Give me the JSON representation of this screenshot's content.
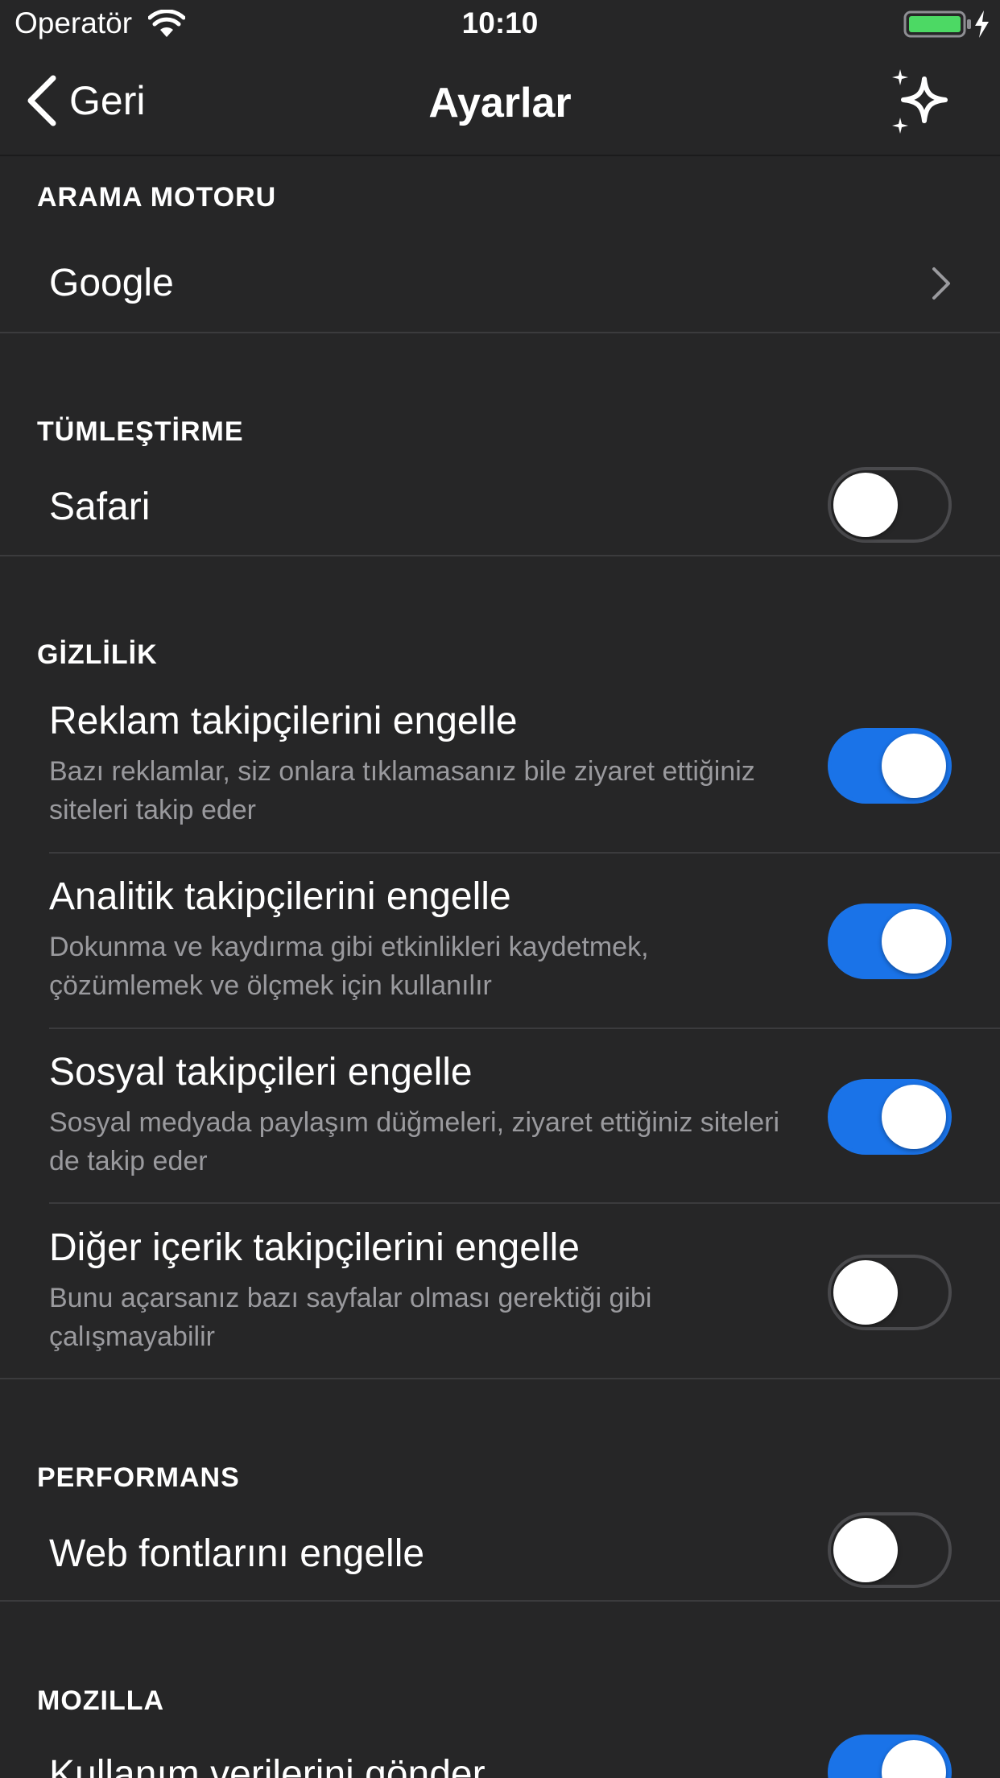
{
  "status_bar": {
    "carrier": "Operatör",
    "time": "10:10"
  },
  "nav": {
    "back_label": "Geri",
    "title": "Ayarlar"
  },
  "colors": {
    "background": "#262627",
    "toggle_on": "#1a73e8",
    "battery": "#4cd964",
    "secondary_text": "#9a9a9e"
  },
  "sections": {
    "search": {
      "header": "ARAMA MOTORU",
      "engine": "Google"
    },
    "integration": {
      "header": "TÜMLEŞTİRME",
      "safari": {
        "label": "Safari",
        "on": false
      }
    },
    "privacy": {
      "header": "GİZLİLİK",
      "items": [
        {
          "label": "Reklam takipçilerini engelle",
          "description": "Bazı reklamlar, siz onlara tıklamasanız bile ziyaret ettiğiniz siteleri takip eder",
          "on": true
        },
        {
          "label": "Analitik takipçilerini engelle",
          "description": "Dokunma ve kaydırma gibi etkinlikleri kaydetmek, çözümlemek ve ölçmek için kullanılır",
          "on": true
        },
        {
          "label": "Sosyal takipçileri engelle",
          "description": "Sosyal medyada paylaşım düğmeleri, ziyaret ettiğiniz siteleri de takip eder",
          "on": true
        },
        {
          "label": "Diğer içerik takipçilerini engelle",
          "description": "Bunu açarsanız bazı sayfalar olması gerektiği gibi çalışmayabilir",
          "on": false
        }
      ]
    },
    "performance": {
      "header": "PERFORMANS",
      "web_fonts": {
        "label": "Web fontlarını engelle",
        "on": false
      }
    },
    "mozilla": {
      "header": "MOZILLA",
      "usage_data": {
        "label": "Kullanım verilerini gönder",
        "on": true
      }
    }
  }
}
